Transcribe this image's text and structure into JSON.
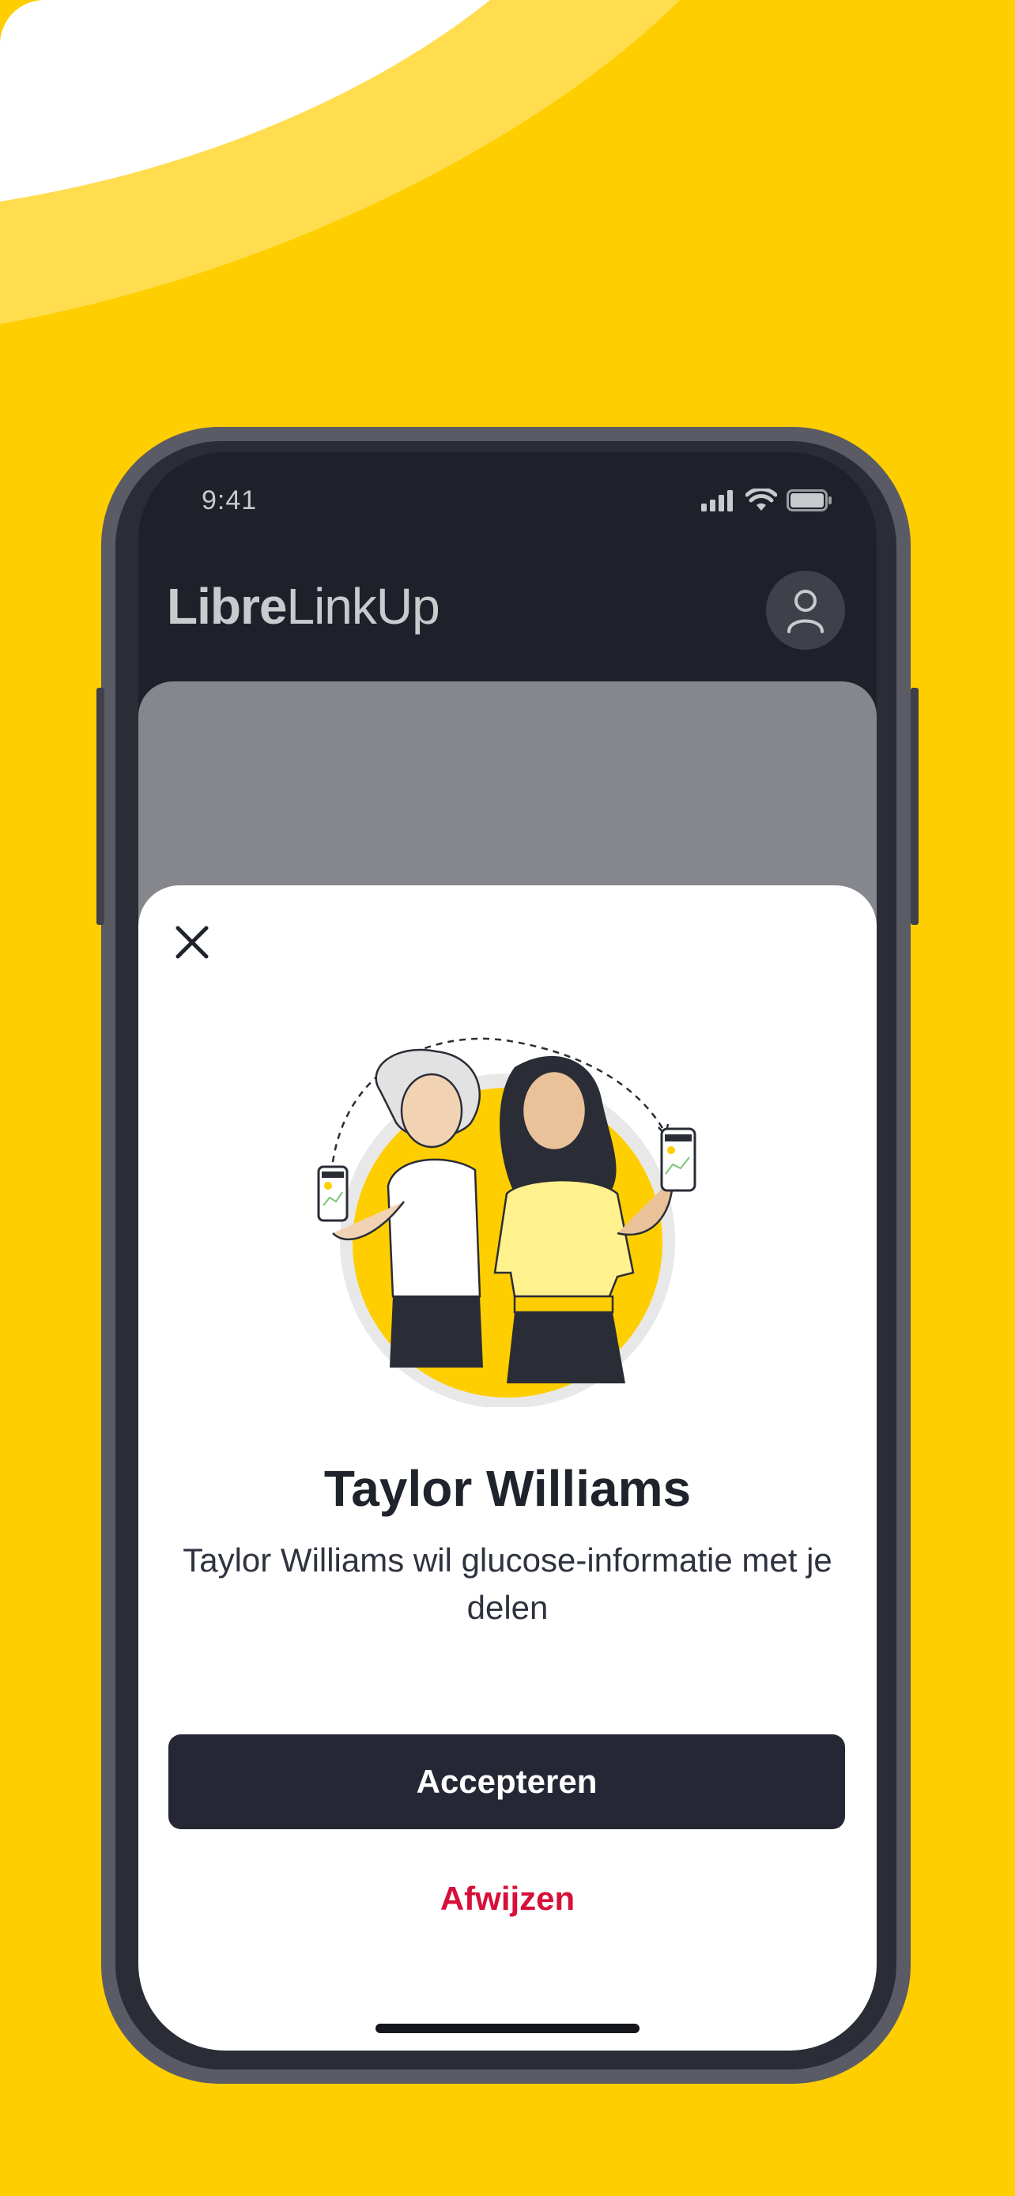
{
  "colors": {
    "background": "#FFCE00",
    "phone_frame": "#5A5B64",
    "screen_dark": "#1E2129",
    "accept_button": "#252834",
    "decline_text": "#D6103A",
    "sheet": "#FFFFFF"
  },
  "status_bar": {
    "time": "9:41",
    "icons": [
      "cellular-signal-icon",
      "wifi-icon",
      "battery-icon"
    ]
  },
  "app_header": {
    "title_bold": "Libre",
    "title_regular": "LinkUp",
    "profile_icon": "profile-icon"
  },
  "invite_sheet": {
    "close_icon": "close-icon",
    "illustration": "two-women-sharing-phones-illustration",
    "name": "Taylor Williams",
    "message": "Taylor Williams wil glucose-informatie met je delen",
    "accept_label": "Accepteren",
    "decline_label": "Afwijzen"
  }
}
